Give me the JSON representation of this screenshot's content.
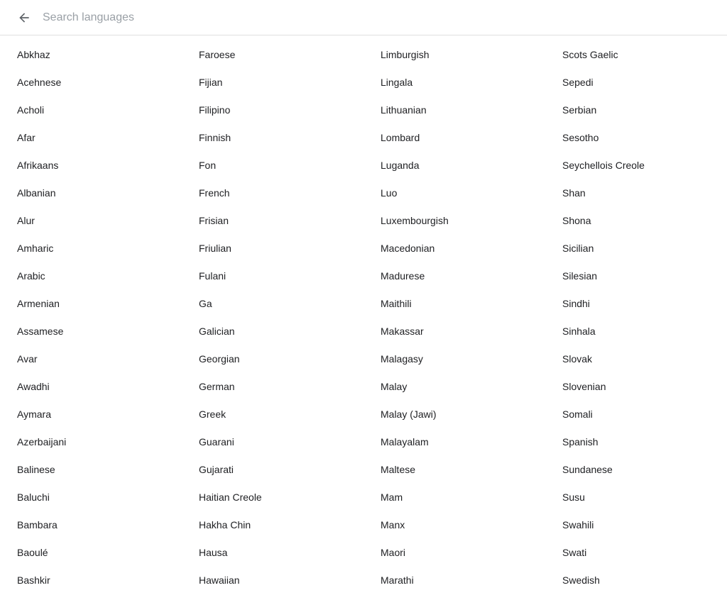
{
  "header": {
    "search_placeholder": "Search languages",
    "back_label": "Back"
  },
  "languages": {
    "col1": [
      "Abkhaz",
      "Acehnese",
      "Acholi",
      "Afar",
      "Afrikaans",
      "Albanian",
      "Alur",
      "Amharic",
      "Arabic",
      "Armenian",
      "Assamese",
      "Avar",
      "Awadhi",
      "Aymara",
      "Azerbaijani",
      "Balinese",
      "Baluchi",
      "Bambara",
      "Baoulé",
      "Bashkir"
    ],
    "col2": [
      "Faroese",
      "Fijian",
      "Filipino",
      "Finnish",
      "Fon",
      "French",
      "Frisian",
      "Friulian",
      "Fulani",
      "Ga",
      "Galician",
      "Georgian",
      "German",
      "Greek",
      "Guarani",
      "Gujarati",
      "Haitian Creole",
      "Hakha Chin",
      "Hausa",
      "Hawaiian"
    ],
    "col3": [
      "Limburgish",
      "Lingala",
      "Lithuanian",
      "Lombard",
      "Luganda",
      "Luo",
      "Luxembourgish",
      "Macedonian",
      "Madurese",
      "Maithili",
      "Makassar",
      "Malagasy",
      "Malay",
      "Malay (Jawi)",
      "Malayalam",
      "Maltese",
      "Mam",
      "Manx",
      "Maori",
      "Marathi"
    ],
    "col4": [
      "Scots Gaelic",
      "Sepedi",
      "Serbian",
      "Sesotho",
      "Seychellois Creole",
      "Shan",
      "Shona",
      "Sicilian",
      "Silesian",
      "Sindhi",
      "Sinhala",
      "Slovak",
      "Slovenian",
      "Somali",
      "Spanish",
      "Sundanese",
      "Susu",
      "Swahili",
      "Swati",
      "Swedish"
    ]
  }
}
